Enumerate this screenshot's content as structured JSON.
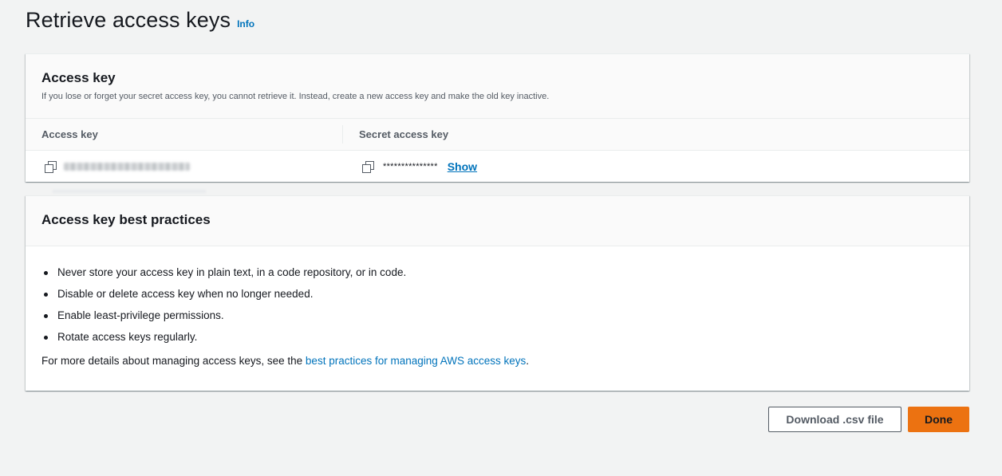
{
  "page": {
    "title": "Retrieve access keys",
    "info_label": "Info"
  },
  "access_key_card": {
    "title": "Access key",
    "description": "If you lose or forget your secret access key, you cannot retrieve it. Instead, create a new access key and make the old key inactive.",
    "columns": {
      "access_key": "Access key",
      "secret_access_key": "Secret access key"
    },
    "secret_masked": "***************",
    "show_label": "Show"
  },
  "best_practices_card": {
    "title": "Access key best practices",
    "items": [
      "Never store your access key in plain text, in a code repository, or in code.",
      "Disable or delete access key when no longer needed.",
      "Enable least-privilege permissions.",
      "Rotate access keys regularly."
    ],
    "more_prefix": "For more details about managing access keys, see the ",
    "more_link": "best practices for managing AWS access keys",
    "more_suffix": "."
  },
  "actions": {
    "download_label": "Download .csv file",
    "done_label": "Done"
  },
  "icons": {
    "copy": "copy-icon"
  },
  "colors": {
    "link": "#0073bb",
    "primary_button": "#ec7211",
    "background": "#f2f3f3"
  }
}
